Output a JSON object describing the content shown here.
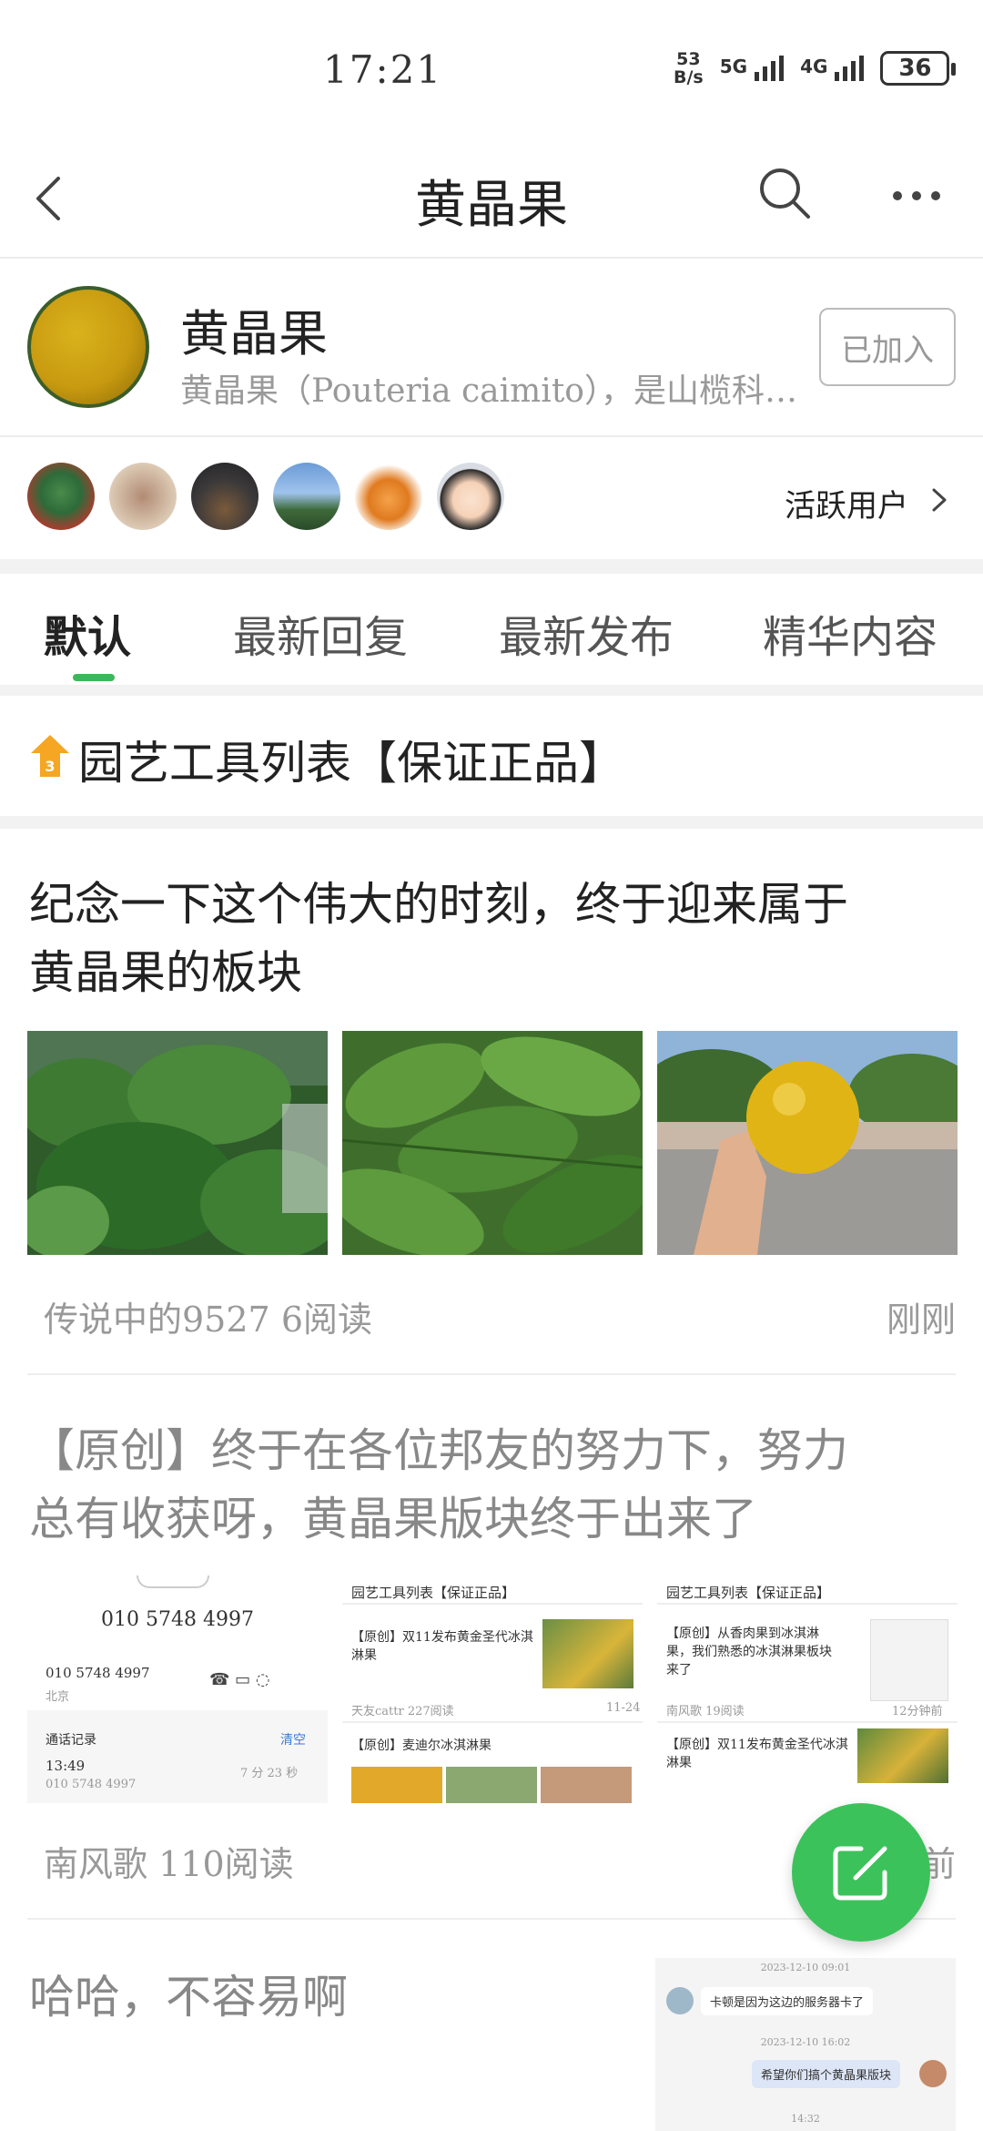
{
  "status_bar": {
    "time": "17:21",
    "net_speed_value": "53",
    "net_speed_unit": "B/s",
    "signal1_label": "5G",
    "signal2_label": "4G",
    "battery": "36"
  },
  "nav": {
    "title": "黄晶果"
  },
  "forum": {
    "name": "黄晶果",
    "description": "黄晶果（Pouteria caimito），是山榄科桃榄属植物",
    "joined_label": "已加入"
  },
  "active_users": {
    "label": "活跃用户"
  },
  "tabs": [
    {
      "label": "默认",
      "active": true
    },
    {
      "label": "最新回复",
      "active": false
    },
    {
      "label": "最新发布",
      "active": false
    },
    {
      "label": "精华内容",
      "active": false
    }
  ],
  "pinned": {
    "badge": "3",
    "title": "园艺工具列表【保证正品】"
  },
  "posts": [
    {
      "title_line1": "纪念一下这个伟大的时刻，终于迎来属于",
      "title_line2": "黄晶果的板块",
      "author": "传说中的9527",
      "reads": "6阅读",
      "time": "刚刚"
    },
    {
      "title_line1": "【原创】终于在各位邦友的努力下，努力",
      "title_line2": "总有收获呀，黄晶果版块终于出来了",
      "author": "南风歌",
      "reads": "110阅读",
      "time": "前"
    },
    {
      "title_line1": "哈哈，不容易啊"
    }
  ],
  "shot1": {
    "number_big": "010 5748 4997",
    "number_small": "010 5748 4997",
    "location": "北京",
    "call_log": "通话记录",
    "clear": "清空",
    "call_time": "13:49",
    "call_number": "010 5748 4997",
    "duration": "7 分 23 秒"
  },
  "shot2": {
    "header": "园艺工具列表【保证正品】",
    "item1": "【原创】双11发布黄金圣代冰淇淋果",
    "item1_meta": "天友cattr 227阅读",
    "item1_time": "11-24",
    "item2": "【原创】麦迪尔冰淇淋果"
  },
  "shot3": {
    "header": "园艺工具列表【保证正品】",
    "item1": "【原创】从香肉果到冰淇淋果，我们熟悉的冰淇淋果板块来了",
    "item1_meta": "南风歌 19阅读",
    "item1_time": "12分钟前",
    "item2": "【原创】双11发布黄金圣代冰淇淋果"
  },
  "shot4": {
    "date1": "2023-12-10 09:01",
    "msg1": "卡顿是因为这边的服务器卡了",
    "date2": "2023-12-10 16:02",
    "msg2": "希望你们搞个黄晶果版块",
    "time3": "14:32"
  },
  "icons": {
    "back": "chevron-left-icon",
    "search": "search-icon",
    "more": "more-dots-icon",
    "fab": "compose-icon"
  },
  "colors": {
    "accent": "#3cb85a",
    "fab": "#3cc25a",
    "pin_badge": "#f5a623"
  }
}
